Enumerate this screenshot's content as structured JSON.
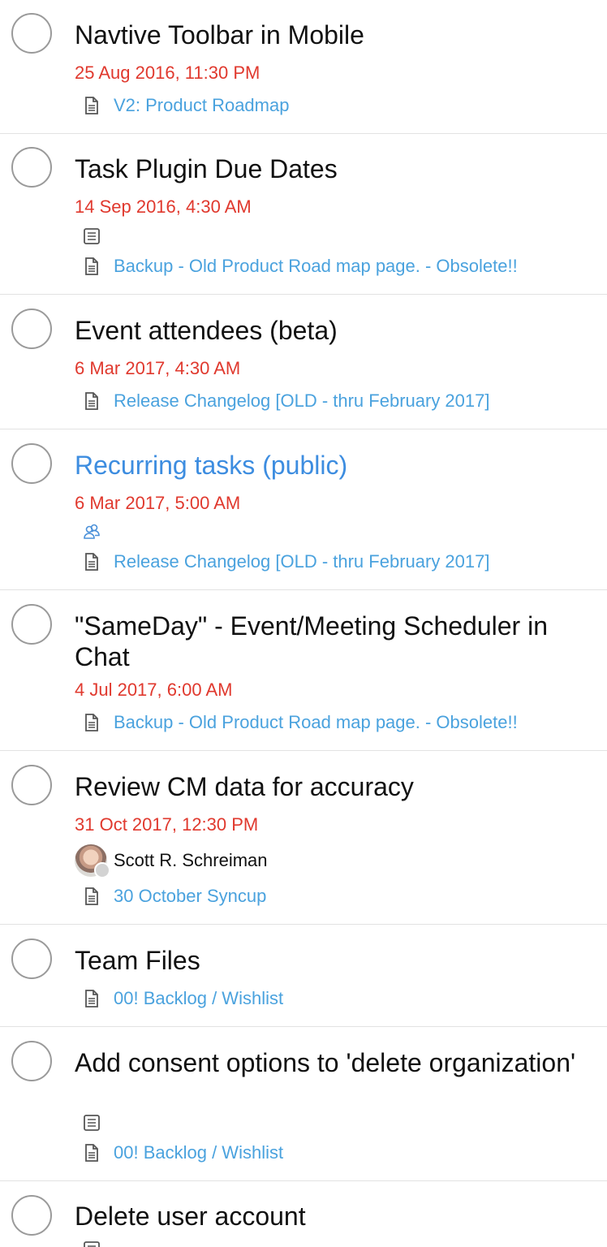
{
  "tasks": [
    {
      "title": "Navtive Toolbar in Mobile",
      "due": "25 Aug 2016, 11:30 PM",
      "page": "V2: Product Roadmap"
    },
    {
      "title": "Task Plugin Due Dates",
      "due": "14 Sep 2016, 4:30 AM",
      "page": "Backup - Old Product Road map page. - Obsolete!!",
      "icons": [
        "description-icon"
      ]
    },
    {
      "title": "Event attendees (beta)",
      "due": "6 Mar 2017, 4:30 AM",
      "page": "Release Changelog [OLD - thru February 2017]"
    },
    {
      "title": "Recurring tasks (public)",
      "due": "6 Mar 2017, 5:00 AM",
      "page": "Release Changelog [OLD - thru February 2017]",
      "icons": [
        "public-users-icon"
      ],
      "title_color": "#3d8de0"
    },
    {
      "title": "\"SameDay\" - Event/Meeting Scheduler in Chat",
      "due": "4 Jul 2017, 6:00 AM",
      "page": "Backup - Old Product Road map page. - Obsolete!!"
    },
    {
      "title": "Review CM data for accuracy",
      "due": "31 Oct 2017, 12:30 PM",
      "assignee": "Scott R. Schreiman",
      "page": "30 October Syncup"
    },
    {
      "title": "Team Files",
      "page": "00! Backlog / Wishlist"
    },
    {
      "title": "Add consent options to 'delete organization'",
      "page": "00! Backlog / Wishlist",
      "icons": [
        "description-icon"
      ]
    },
    {
      "title": "Delete user account",
      "icons": [
        "description-icon"
      ]
    }
  ],
  "colors": {
    "due": "#e0392e",
    "link": "#4aa2de",
    "title": "#111111",
    "divider": "#e2e2e2"
  }
}
